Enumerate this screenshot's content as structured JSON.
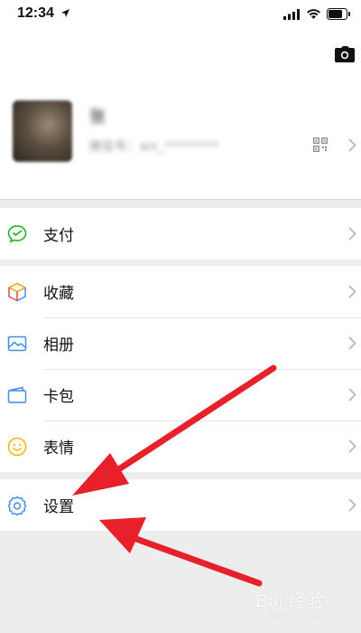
{
  "status_bar": {
    "time": "12:34",
    "icons": [
      "location-arrow-icon",
      "signal-icon",
      "wifi-icon",
      "battery-icon"
    ]
  },
  "profile": {
    "nickname": "张",
    "wechat_id": "微信号：wx_********",
    "icons": [
      "camera-icon",
      "qr-code-icon",
      "chevron-right-icon"
    ]
  },
  "menu": {
    "pay": {
      "label": "支付",
      "icon": "wechat-pay-icon"
    },
    "favorites": {
      "label": "收藏",
      "icon": "favorites-cube-icon"
    },
    "album": {
      "label": "相册",
      "icon": "album-photo-icon"
    },
    "cards": {
      "label": "卡包",
      "icon": "card-wallet-icon"
    },
    "stickers": {
      "label": "表情",
      "icon": "smiley-icon"
    },
    "settings": {
      "label": "设置",
      "icon": "gear-icon"
    }
  },
  "annotations": {
    "arrow_color": "#e8202a",
    "target": "settings"
  },
  "watermark": {
    "brand": "Bai 经验",
    "site": "jingyan.baidu.com"
  },
  "colors": {
    "background": "#ededed",
    "wechat_green": "#1aad19",
    "chevron": "#b2b2b2"
  }
}
